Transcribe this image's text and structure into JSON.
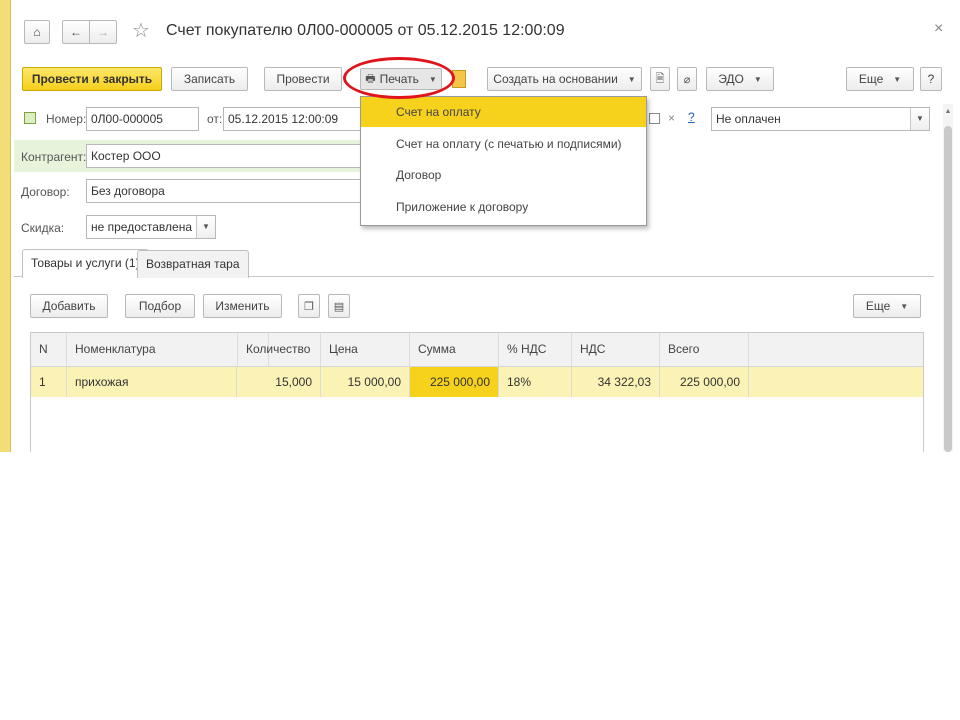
{
  "window": {
    "title": "Счет покупателю 0Л00-000005 от 05.12.2015 12:00:09",
    "close_glyph": "×"
  },
  "nav": {
    "home_glyph": "⌂",
    "back_glyph": "←",
    "forward_glyph": "→",
    "star_glyph": "☆"
  },
  "toolbar": {
    "post_close_label": "Провести и закрыть",
    "save_label": "Записать",
    "post_label": "Провести",
    "print_label": "Печать",
    "create_based_label": "Создать на основании",
    "edo_label": "ЭДО",
    "more_label": "Еще",
    "help_label": "?"
  },
  "form": {
    "number_label": "Номер:",
    "number_value": "0Л00-000005",
    "date_label": "от:",
    "date_value": "05.12.2015 12:00:09",
    "status_value": "Не оплачен",
    "help_link": "?",
    "counterparty_label": "Контрагент:",
    "counterparty_value": "Костер ООО",
    "contract_label": "Договор:",
    "contract_value": "Без договора",
    "discount_label": "Скидка:",
    "discount_value": "не предоставлена"
  },
  "tabs": [
    {
      "label": "Товары и услуги (1)",
      "active": true
    },
    {
      "label": "Возвратная тара",
      "active": false
    }
  ],
  "table_toolbar": {
    "add_label": "Добавить",
    "pick_label": "Подбор",
    "edit_label": "Изменить",
    "more_label": "Еще"
  },
  "table": {
    "headers": [
      "N",
      "Номенклатура",
      "Количество",
      "Цена",
      "Сумма",
      "% НДС",
      "НДС",
      "Всего"
    ],
    "rows": [
      {
        "n": "1",
        "item": "прихожая",
        "qty": "15,000",
        "price": "15 000,00",
        "sum": "225 000,00",
        "vat_rate": "18%",
        "vat": "34 322,03",
        "total": "225 000,00"
      }
    ]
  },
  "print_menu": {
    "items": [
      "Счет на оплату",
      "Счет на оплату (с печатью и подписями)",
      "Договор",
      "Приложение к договору"
    ],
    "highlighted_index": 0
  },
  "colors": {
    "accent_yellow": "#f6d21c",
    "highlight_row": "#fbf2b5",
    "annotation_red": "#e0141a",
    "counterparty_bg": "#e8f3dc"
  }
}
